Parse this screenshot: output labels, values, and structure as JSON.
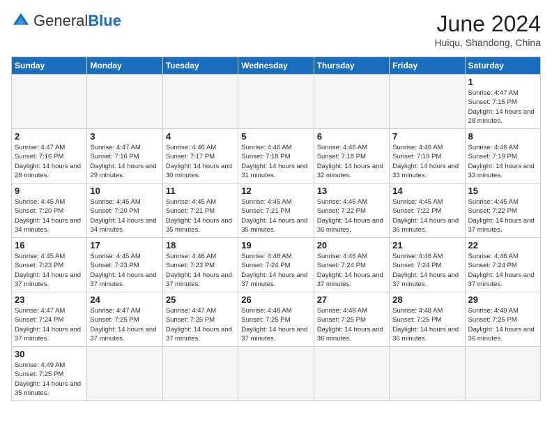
{
  "header": {
    "logo_general": "General",
    "logo_blue": "Blue",
    "month_title": "June 2024",
    "location": "Huiqu, Shandong, China"
  },
  "days_of_week": [
    "Sunday",
    "Monday",
    "Tuesday",
    "Wednesday",
    "Thursday",
    "Friday",
    "Saturday"
  ],
  "weeks": [
    [
      {
        "day": "",
        "info": ""
      },
      {
        "day": "",
        "info": ""
      },
      {
        "day": "",
        "info": ""
      },
      {
        "day": "",
        "info": ""
      },
      {
        "day": "",
        "info": ""
      },
      {
        "day": "",
        "info": ""
      },
      {
        "day": "1",
        "info": "Sunrise: 4:47 AM\nSunset: 7:15 PM\nDaylight: 14 hours and 28 minutes."
      }
    ],
    [
      {
        "day": "2",
        "info": "Sunrise: 4:47 AM\nSunset: 7:16 PM\nDaylight: 14 hours and 28 minutes."
      },
      {
        "day": "3",
        "info": "Sunrise: 4:47 AM\nSunset: 7:16 PM\nDaylight: 14 hours and 29 minutes."
      },
      {
        "day": "4",
        "info": "Sunrise: 4:46 AM\nSunset: 7:17 PM\nDaylight: 14 hours and 30 minutes."
      },
      {
        "day": "5",
        "info": "Sunrise: 4:46 AM\nSunset: 7:18 PM\nDaylight: 14 hours and 31 minutes."
      },
      {
        "day": "6",
        "info": "Sunrise: 4:46 AM\nSunset: 7:18 PM\nDaylight: 14 hours and 32 minutes."
      },
      {
        "day": "7",
        "info": "Sunrise: 4:46 AM\nSunset: 7:19 PM\nDaylight: 14 hours and 33 minutes."
      },
      {
        "day": "8",
        "info": "Sunrise: 4:46 AM\nSunset: 7:19 PM\nDaylight: 14 hours and 33 minutes."
      }
    ],
    [
      {
        "day": "9",
        "info": "Sunrise: 4:45 AM\nSunset: 7:20 PM\nDaylight: 14 hours and 34 minutes."
      },
      {
        "day": "10",
        "info": "Sunrise: 4:45 AM\nSunset: 7:20 PM\nDaylight: 14 hours and 34 minutes."
      },
      {
        "day": "11",
        "info": "Sunrise: 4:45 AM\nSunset: 7:21 PM\nDaylight: 14 hours and 35 minutes."
      },
      {
        "day": "12",
        "info": "Sunrise: 4:45 AM\nSunset: 7:21 PM\nDaylight: 14 hours and 35 minutes."
      },
      {
        "day": "13",
        "info": "Sunrise: 4:45 AM\nSunset: 7:22 PM\nDaylight: 14 hours and 36 minutes."
      },
      {
        "day": "14",
        "info": "Sunrise: 4:45 AM\nSunset: 7:22 PM\nDaylight: 14 hours and 36 minutes."
      },
      {
        "day": "15",
        "info": "Sunrise: 4:45 AM\nSunset: 7:22 PM\nDaylight: 14 hours and 37 minutes."
      }
    ],
    [
      {
        "day": "16",
        "info": "Sunrise: 4:45 AM\nSunset: 7:23 PM\nDaylight: 14 hours and 37 minutes."
      },
      {
        "day": "17",
        "info": "Sunrise: 4:45 AM\nSunset: 7:23 PM\nDaylight: 14 hours and 37 minutes."
      },
      {
        "day": "18",
        "info": "Sunrise: 4:46 AM\nSunset: 7:23 PM\nDaylight: 14 hours and 37 minutes."
      },
      {
        "day": "19",
        "info": "Sunrise: 4:46 AM\nSunset: 7:24 PM\nDaylight: 14 hours and 37 minutes."
      },
      {
        "day": "20",
        "info": "Sunrise: 4:46 AM\nSunset: 7:24 PM\nDaylight: 14 hours and 37 minutes."
      },
      {
        "day": "21",
        "info": "Sunrise: 4:46 AM\nSunset: 7:24 PM\nDaylight: 14 hours and 37 minutes."
      },
      {
        "day": "22",
        "info": "Sunrise: 4:46 AM\nSunset: 7:24 PM\nDaylight: 14 hours and 37 minutes."
      }
    ],
    [
      {
        "day": "23",
        "info": "Sunrise: 4:47 AM\nSunset: 7:24 PM\nDaylight: 14 hours and 37 minutes."
      },
      {
        "day": "24",
        "info": "Sunrise: 4:47 AM\nSunset: 7:25 PM\nDaylight: 14 hours and 37 minutes."
      },
      {
        "day": "25",
        "info": "Sunrise: 4:47 AM\nSunset: 7:25 PM\nDaylight: 14 hours and 37 minutes."
      },
      {
        "day": "26",
        "info": "Sunrise: 4:48 AM\nSunset: 7:25 PM\nDaylight: 14 hours and 37 minutes."
      },
      {
        "day": "27",
        "info": "Sunrise: 4:48 AM\nSunset: 7:25 PM\nDaylight: 14 hours and 36 minutes."
      },
      {
        "day": "28",
        "info": "Sunrise: 4:48 AM\nSunset: 7:25 PM\nDaylight: 14 hours and 36 minutes."
      },
      {
        "day": "29",
        "info": "Sunrise: 4:49 AM\nSunset: 7:25 PM\nDaylight: 14 hours and 36 minutes."
      }
    ],
    [
      {
        "day": "30",
        "info": "Sunrise: 4:49 AM\nSunset: 7:25 PM\nDaylight: 14 hours and 35 minutes."
      },
      {
        "day": "",
        "info": ""
      },
      {
        "day": "",
        "info": ""
      },
      {
        "day": "",
        "info": ""
      },
      {
        "day": "",
        "info": ""
      },
      {
        "day": "",
        "info": ""
      },
      {
        "day": "",
        "info": ""
      }
    ]
  ]
}
